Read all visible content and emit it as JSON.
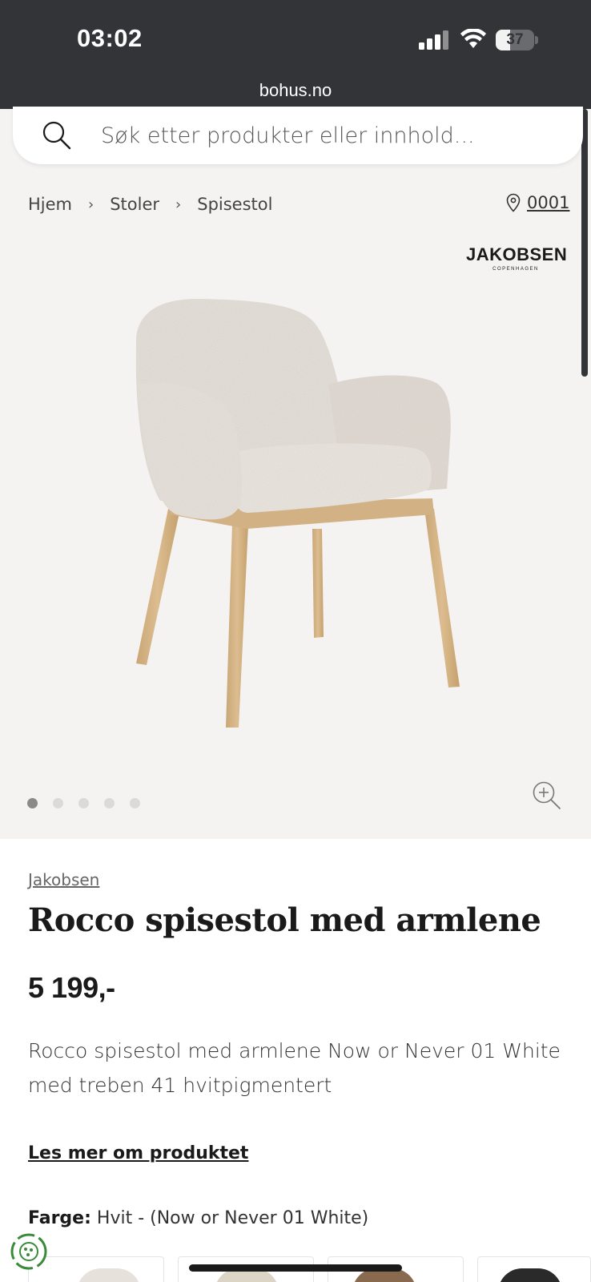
{
  "status_bar": {
    "time": "03:02",
    "battery": "37",
    "battery_level": 0.37
  },
  "browser": {
    "url": "bohus.no"
  },
  "search": {
    "placeholder": "Søk etter produkter eller innhold..."
  },
  "breadcrumb": {
    "items": [
      "Hjem",
      "Stoler",
      "Spisestol"
    ]
  },
  "store": {
    "label": "0001"
  },
  "brand_logo": {
    "name": "JAKOBSEN",
    "sub": "COPENHAGEN"
  },
  "gallery": {
    "dots": 5,
    "active_index": 0
  },
  "product": {
    "brand": "Jakobsen",
    "title": "Rocco spisestol med armlene",
    "price": "5 199,-",
    "description": "Rocco spisestol med armlene Now or Never 01 White med treben 41 hvitpigmentert",
    "read_more": "Les mer om produktet",
    "color_label": "Farge:",
    "color_value": "Hvit - (Now or Never 01 White)"
  },
  "colors": {
    "status_bar_bg": "#333438",
    "page_bg": "#f5f3f2",
    "fabric": "#e6e0da",
    "wood": "#d4b487",
    "eco_green": "#3a8a3a"
  },
  "icons": {
    "search": "search-icon",
    "location": "location-pin-icon",
    "zoom": "zoom-in-icon",
    "eco": "eco-badge-icon"
  }
}
